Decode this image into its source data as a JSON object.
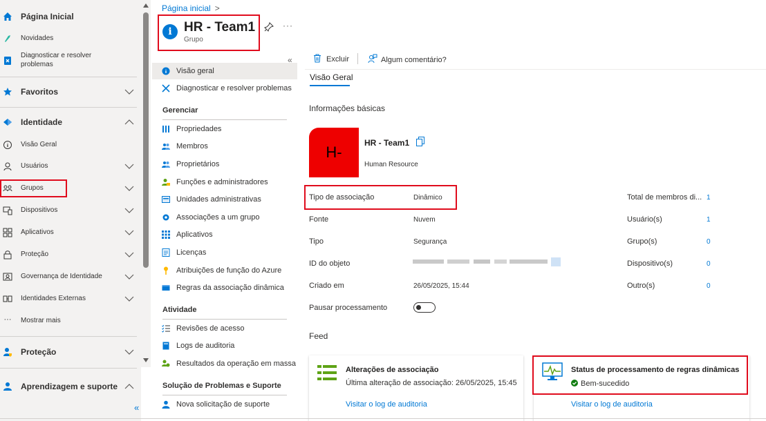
{
  "leftnav": {
    "home": "Página Inicial",
    "whats_new": "Novidades",
    "diagnose": "Diagnosticar e resolver problemas",
    "favorites": "Favoritos",
    "identity": "Identidade",
    "overview": "Visão Geral",
    "users": "Usuários",
    "groups": "Grupos",
    "devices": "Dispositivos",
    "apps": "Aplicativos",
    "protection": "Proteção",
    "governance": "Governança de Identidade",
    "external": "Identidades Externas",
    "show_more": "Mostrar mais",
    "protection_section": "Proteção",
    "learn_support": "Aprendizagem e suporte",
    "collapse": "«"
  },
  "header": {
    "breadcrumb": "Página inicial",
    "title": "HR - Team1",
    "subtitle": "Grupo",
    "more": "···"
  },
  "resmenu": {
    "collapse": "«",
    "items_top": [
      "Visão geral",
      "Diagnosticar e resolver problemas"
    ],
    "manage_title": "Gerenciar",
    "manage": [
      "Propriedades",
      "Membros",
      "Proprietários",
      "Funções e administradores",
      "Unidades administrativas",
      "Associações a um grupo",
      "Aplicativos",
      "Licenças",
      "Atribuições de função do Azure",
      "Regras da associação dinâmica"
    ],
    "activity_title": "Atividade",
    "activity": [
      "Revisões de acesso",
      "Logs de auditoria",
      "Resultados da operação em massa"
    ],
    "support_title": "Solução de Problemas e Suporte",
    "support": [
      "Nova solicitação de suporte"
    ]
  },
  "toolbar": {
    "delete": "Excluir",
    "feedback": "Algum comentário?",
    "tab": "Visão Geral"
  },
  "basic": {
    "title": "Informações básicas",
    "avatar": "H-",
    "name": "HR - Team1",
    "description": "Human Resource",
    "props": [
      {
        "label": "Tipo de associação",
        "value": "Dinâmico"
      },
      {
        "label": "Fonte",
        "value": "Nuvem"
      },
      {
        "label": "Tipo",
        "value": "Segurança"
      },
      {
        "label": "ID do objeto",
        "value": ""
      },
      {
        "label": "Criado em",
        "value": "26/05/2025, 15:44"
      },
      {
        "label": "Pausar processamento",
        "value": ""
      }
    ],
    "pause_processing_on": false,
    "counts": [
      {
        "label": "Total de membros di...",
        "value": "1"
      },
      {
        "label": "Usuário(s)",
        "value": "1"
      },
      {
        "label": "Grupo(s)",
        "value": "0"
      },
      {
        "label": "Dispositivo(s)",
        "value": "0"
      },
      {
        "label": "Outro(s)",
        "value": "0"
      }
    ]
  },
  "feed": {
    "title": "Feed",
    "card1": {
      "title": "Alterações de associação",
      "sub": "Última alteração de associação: 26/05/2025, 15:45",
      "link": "Visitar o log de auditoria"
    },
    "card2": {
      "title": "Status de processamento de regras dinâmicas",
      "status": "Bem-sucedido",
      "link": "Visitar o log de auditoria"
    }
  },
  "colors": {
    "accent": "#0078d4",
    "highlight": "#e00b1c",
    "avatar": "#ee0000",
    "success": "#107c10"
  }
}
